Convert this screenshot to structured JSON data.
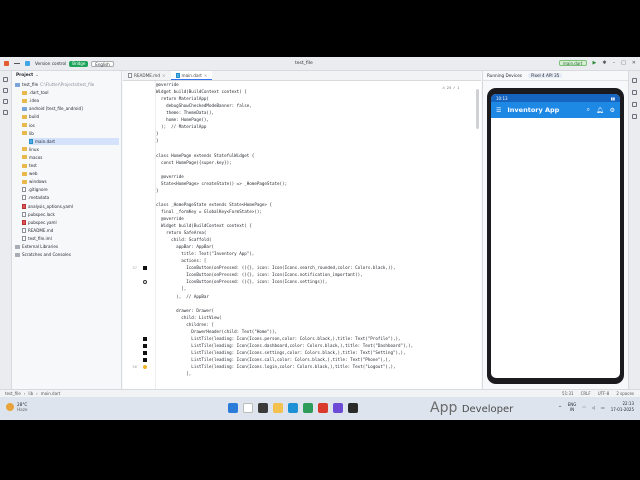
{
  "window": {
    "title": "test_file",
    "menu": [
      "Version control"
    ],
    "branch_label": "Bridge",
    "locale_label": "English",
    "run_target": "main.dart"
  },
  "project_panel": {
    "header": "Project",
    "items": [
      {
        "label": "test_file",
        "path": "C:\\Flutter\\Projects\\test_file",
        "type": "folder-blue",
        "depth": 0
      },
      {
        "label": ".dart_tool",
        "type": "folder",
        "depth": 1
      },
      {
        "label": ".idea",
        "type": "folder",
        "depth": 1
      },
      {
        "label": "android [test_file_android]",
        "type": "folder-blue",
        "depth": 1
      },
      {
        "label": "build",
        "type": "folder",
        "depth": 1
      },
      {
        "label": "ios",
        "type": "folder",
        "depth": 1
      },
      {
        "label": "lib",
        "type": "folder",
        "depth": 1
      },
      {
        "label": "main.dart",
        "type": "dart",
        "depth": 2
      },
      {
        "label": "linux",
        "type": "folder",
        "depth": 1
      },
      {
        "label": "macos",
        "type": "folder",
        "depth": 1
      },
      {
        "label": "test",
        "type": "folder",
        "depth": 1
      },
      {
        "label": "web",
        "type": "folder",
        "depth": 1
      },
      {
        "label": "windows",
        "type": "folder",
        "depth": 1
      },
      {
        "label": ".gitignore",
        "type": "file",
        "depth": 1
      },
      {
        "label": ".metadata",
        "type": "file",
        "depth": 1
      },
      {
        "label": "analysis_options.yaml",
        "type": "yaml",
        "depth": 1
      },
      {
        "label": "pubspec.lock",
        "type": "file",
        "depth": 1
      },
      {
        "label": "pubspec.yaml",
        "type": "yaml",
        "depth": 1
      },
      {
        "label": "README.md",
        "type": "file",
        "depth": 1
      },
      {
        "label": "test_file.iml",
        "type": "file",
        "depth": 1
      },
      {
        "label": "External Libraries",
        "type": "folder-grey",
        "depth": 0
      },
      {
        "label": "Scratches and Consoles",
        "type": "folder-grey",
        "depth": 0
      }
    ]
  },
  "editor": {
    "tabs": [
      "README.md",
      "main.dart"
    ],
    "active_tab": "main.dart",
    "inspection": "⚠ 25 ✓ 1",
    "lines": [
      {
        "n": "",
        "code": "@override",
        "mark": ""
      },
      {
        "n": "",
        "code": "Widget build(BuildContext context) {",
        "mark": ""
      },
      {
        "n": "",
        "code": "  return MaterialApp(",
        "mark": ""
      },
      {
        "n": "",
        "code": "    debugShowCheckedModeBanner: false,",
        "mark": ""
      },
      {
        "n": "",
        "code": "    theme: ThemeData(),",
        "mark": ""
      },
      {
        "n": "",
        "code": "    home: HomePage(),",
        "mark": ""
      },
      {
        "n": "",
        "code": "  );  // MaterialApp",
        "mark": ""
      },
      {
        "n": "",
        "code": "}",
        "mark": ""
      },
      {
        "n": "",
        "code": "}",
        "mark": ""
      },
      {
        "n": "",
        "code": "",
        "mark": ""
      },
      {
        "n": "",
        "code": "class HomePage extends StatefulWidget {",
        "mark": ""
      },
      {
        "n": "",
        "code": "  const HomePage({super.key});",
        "mark": ""
      },
      {
        "n": "",
        "code": "",
        "mark": ""
      },
      {
        "n": "",
        "code": "  @override",
        "mark": ""
      },
      {
        "n": "",
        "code": "  State<HomePage> createState() => _HomePageState();",
        "mark": ""
      },
      {
        "n": "",
        "code": "}",
        "mark": ""
      },
      {
        "n": "",
        "code": "",
        "mark": ""
      },
      {
        "n": "",
        "code": "class _HomePageState extends State<HomePage> {",
        "mark": ""
      },
      {
        "n": "",
        "code": "  final _formKey = GlobalKey<FormState>();",
        "mark": ""
      },
      {
        "n": "",
        "code": "  @override",
        "mark": ""
      },
      {
        "n": "",
        "code": "  Widget build(BuildContext context) {",
        "mark": ""
      },
      {
        "n": "",
        "code": "    return SafeArea(",
        "mark": ""
      },
      {
        "n": "",
        "code": "      child: Scaffold(",
        "mark": ""
      },
      {
        "n": "",
        "code": "        appBar: AppBar(",
        "mark": ""
      },
      {
        "n": "",
        "code": "          title: Text(\"Inventory App\"),",
        "mark": ""
      },
      {
        "n": "",
        "code": "          actions: [",
        "mark": ""
      },
      {
        "n": "37",
        "code": "            IconButton(onPressed: (){}, icon: Icon(Icons.search_rounded,color: Colors.black,)),",
        "mark": "sq"
      },
      {
        "n": "",
        "code": "            IconButton(onPressed: (){}, icon: Icon(Icons.notification_important)),",
        "mark": ""
      },
      {
        "n": "",
        "code": "            IconButton(onPressed: (){}, icon: Icon(Icons.settings)),",
        "mark": "gear"
      },
      {
        "n": "",
        "code": "          ],",
        "mark": ""
      },
      {
        "n": "",
        "code": "        ),  // AppBar",
        "mark": ""
      },
      {
        "n": "",
        "code": "",
        "mark": ""
      },
      {
        "n": "",
        "code": "        drawer: Drawer(",
        "mark": ""
      },
      {
        "n": "",
        "code": "          child: ListView(",
        "mark": ""
      },
      {
        "n": "",
        "code": "            children: [",
        "mark": ""
      },
      {
        "n": "",
        "code": "              DrawerHeader(child: Text(\"Home\")),",
        "mark": ""
      },
      {
        "n": "",
        "code": "              ListTile(leading: Icon(Icons.person,color: Colors.black,),title: Text(\"Profile\"),),",
        "mark": "sq"
      },
      {
        "n": "",
        "code": "              ListTile(leading: Icon(Icons.dashboard,color: Colors.black,),title: Text(\"Dashboard\"),),",
        "mark": "sq"
      },
      {
        "n": "",
        "code": "              ListTile(leading: Icon(Icons.settings,color: Colors.black,),title: Text(\"Setting\"),),",
        "mark": "sq"
      },
      {
        "n": "",
        "code": "              ListTile(leading: Icon(Icons.call,color: Colors.black,),title: Text(\"Phone\"),),",
        "mark": "sq"
      },
      {
        "n": "56",
        "code": "              ListTile(leading: Icon(Icons.login,color: Colors.black,),title: Text(\"Logout\"),),",
        "mark": "bulb"
      },
      {
        "n": "",
        "code": "            ],",
        "mark": ""
      }
    ]
  },
  "running_devices": {
    "header": "Running Devices",
    "device": "Pixel 4 API 35",
    "phone": {
      "time": "10:13",
      "app_title": "Inventory App",
      "icons": [
        "menu-icon",
        "search-icon",
        "notification-icon",
        "settings-icon"
      ]
    }
  },
  "status_bar": {
    "crumbs": [
      "test_file",
      "lib",
      "main.dart"
    ],
    "position": "51:31",
    "line_sep": "CRLF",
    "encoding": "UTF-8",
    "indent": "2 spaces"
  },
  "taskbar": {
    "weather_temp": "28°C",
    "weather_desc": "Haze",
    "lang": "ENG",
    "region": "IN",
    "time": "22:13",
    "date": "17-01-2025"
  },
  "watermark": {
    "title": "App",
    "subtitle": "Developer"
  },
  "colors": {
    "accent": "#3574f0",
    "appbar": "#1e88e5",
    "statusbar_phone": "#1565c0"
  }
}
